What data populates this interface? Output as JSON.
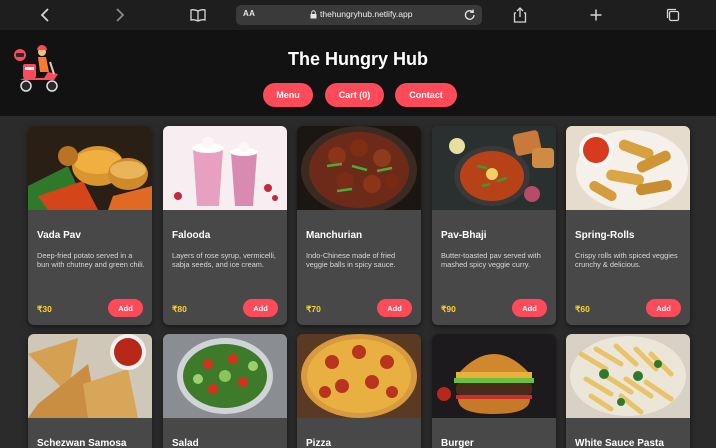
{
  "browser": {
    "text_size_label": "AA",
    "url": "thehungryhub.netlify.app"
  },
  "header": {
    "title": "The Hungry Hub",
    "nav": [
      {
        "label": "Menu"
      },
      {
        "label": "Cart (0)"
      },
      {
        "label": "Contact"
      }
    ]
  },
  "menu": {
    "items": [
      {
        "name": "Vada Pav",
        "description": "Deep-fried potato served in a bun with chutney and green chili.",
        "price": "₹30",
        "add_label": "Add",
        "image": "vada-pav-image"
      },
      {
        "name": "Falooda",
        "description": "Layers of rose syrup, vermicelli, sabja seeds, and ice cream.",
        "price": "₹80",
        "add_label": "Add",
        "image": "falooda-image"
      },
      {
        "name": "Manchurian",
        "description": "Indo-Chinese made of fried veggie balls in spicy sauce.",
        "price": "₹70",
        "add_label": "Add",
        "image": "manchurian-image"
      },
      {
        "name": "Pav-Bhaji",
        "description": "Butter-toasted pav served with mashed spicy veggie curry.",
        "price": "₹90",
        "add_label": "Add",
        "image": "pav-bhaji-image"
      },
      {
        "name": "Spring-Rolls",
        "description": "Crispy rolls with spiced veggies crunchy & delicious.",
        "price": "₹60",
        "add_label": "Add",
        "image": "spring-rolls-image"
      },
      {
        "name": "Schezwan Samosa",
        "description": "",
        "price": "",
        "add_label": "",
        "image": "samosa-image"
      },
      {
        "name": "Salad",
        "description": "",
        "price": "",
        "add_label": "",
        "image": "salad-image"
      },
      {
        "name": "Pizza",
        "description": "",
        "price": "",
        "add_label": "",
        "image": "pizza-image"
      },
      {
        "name": "Burger",
        "description": "",
        "price": "",
        "add_label": "",
        "image": "burger-image"
      },
      {
        "name": "White Sauce Pasta",
        "description": "",
        "price": "",
        "add_label": "",
        "image": "pasta-image"
      }
    ]
  },
  "colors": {
    "accent": "#ff4a5a",
    "price": "#ffd21f",
    "header_bg": "#121212",
    "page_bg": "#2b2b2b",
    "card_bg": "#484848"
  }
}
